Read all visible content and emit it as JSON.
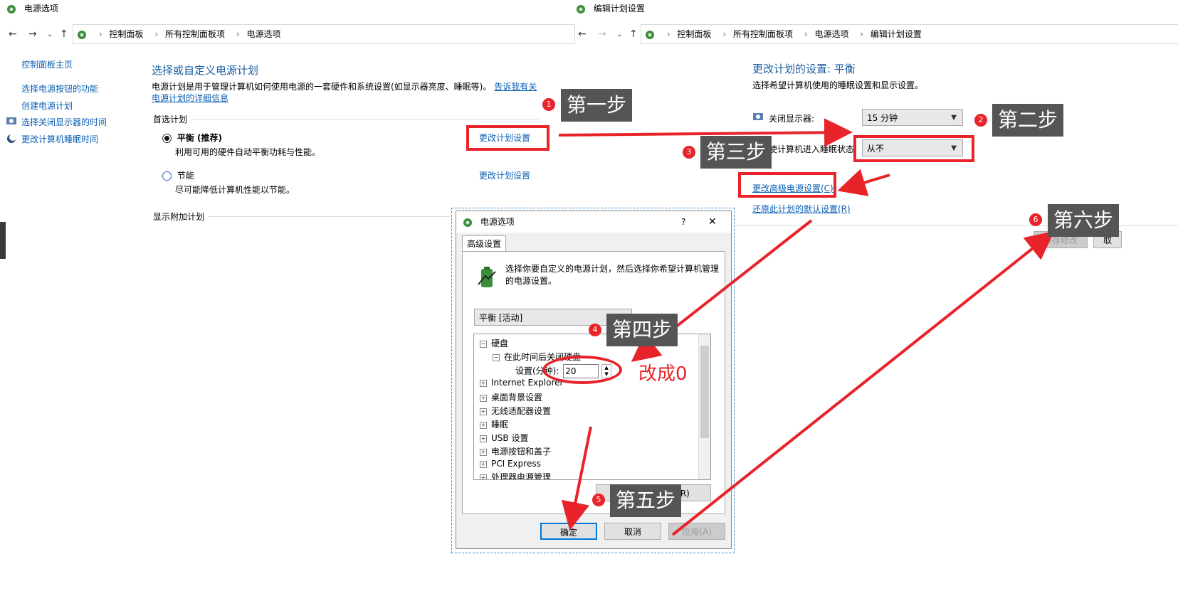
{
  "left_window": {
    "title": "电源选项",
    "breadcrumb": [
      "控制面板",
      "所有控制面板项",
      "电源选项"
    ],
    "sidebar": [
      "控制面板主页",
      "选择电源按钮的功能",
      "创建电源计划",
      "选择关闭显示器的时间",
      "更改计算机睡眠时间"
    ],
    "heading": "选择或自定义电源计划",
    "description": "电源计划是用于管理计算机如何使用电源的一套硬件和系统设置(如显示器亮度、睡眠等)。",
    "description_link": "告诉我有关电源计划的详细信息",
    "preferred_label": "首选计划",
    "plans": [
      {
        "name": "平衡 (推荐)",
        "desc": "利用可用的硬件自动平衡功耗与性能。",
        "link": "更改计划设置",
        "selected": true
      },
      {
        "name": "节能",
        "desc": "尽可能降低计算机性能以节能。",
        "link": "更改计划设置",
        "selected": false
      }
    ],
    "extra_plans": "显示附加计划"
  },
  "right_window": {
    "title": "编辑计划设置",
    "breadcrumb": [
      "控制面板",
      "所有控制面板项",
      "电源选项",
      "编辑计划设置"
    ],
    "heading": "更改计划的设置: 平衡",
    "subheading": "选择希望计算机使用的睡眠设置和显示设置。",
    "display_off_label": "关闭显示器:",
    "display_off_value": "15 分钟",
    "sleep_label": "使计算机进入睡眠状态:",
    "sleep_value": "从不",
    "advanced_link": "更改高级电源设置(C)",
    "restore_link": "还原此计划的默认设置(R)",
    "save_button": "保存修改",
    "cancel_button": "取"
  },
  "dialog": {
    "title": "电源选项",
    "help": "?",
    "close": "✕",
    "tab": "高级设置",
    "intro": "选择你要自定义的电源计划，然后选择你希望计算机管理的电源设置。",
    "plan_select": "平衡 [活动]",
    "tree": {
      "disk": "硬盘",
      "disk_sub": "在此时间后关闭硬盘",
      "setting_label": "设置(分钟):",
      "setting_value": "20",
      "items": [
        "Internet Explorer",
        "桌面背景设置",
        "无线适配器设置",
        "睡眠",
        "USB 设置",
        "电源按钮和盖子",
        "PCI Express",
        "处理器电源管理"
      ]
    },
    "restore_button": "还原计划默认值(R)",
    "ok": "确定",
    "cancel": "取消",
    "apply": "应用(A)"
  },
  "annotations": {
    "steps": [
      {
        "num": "1",
        "label": "第一步"
      },
      {
        "num": "2",
        "label": "第二步"
      },
      {
        "num": "3",
        "label": "第三步"
      },
      {
        "num": "4",
        "label": "第四步"
      },
      {
        "num": "5",
        "label": "第五步"
      },
      {
        "num": "6",
        "label": "第六步"
      }
    ],
    "note": "改成0",
    "color": "#e8232a"
  }
}
